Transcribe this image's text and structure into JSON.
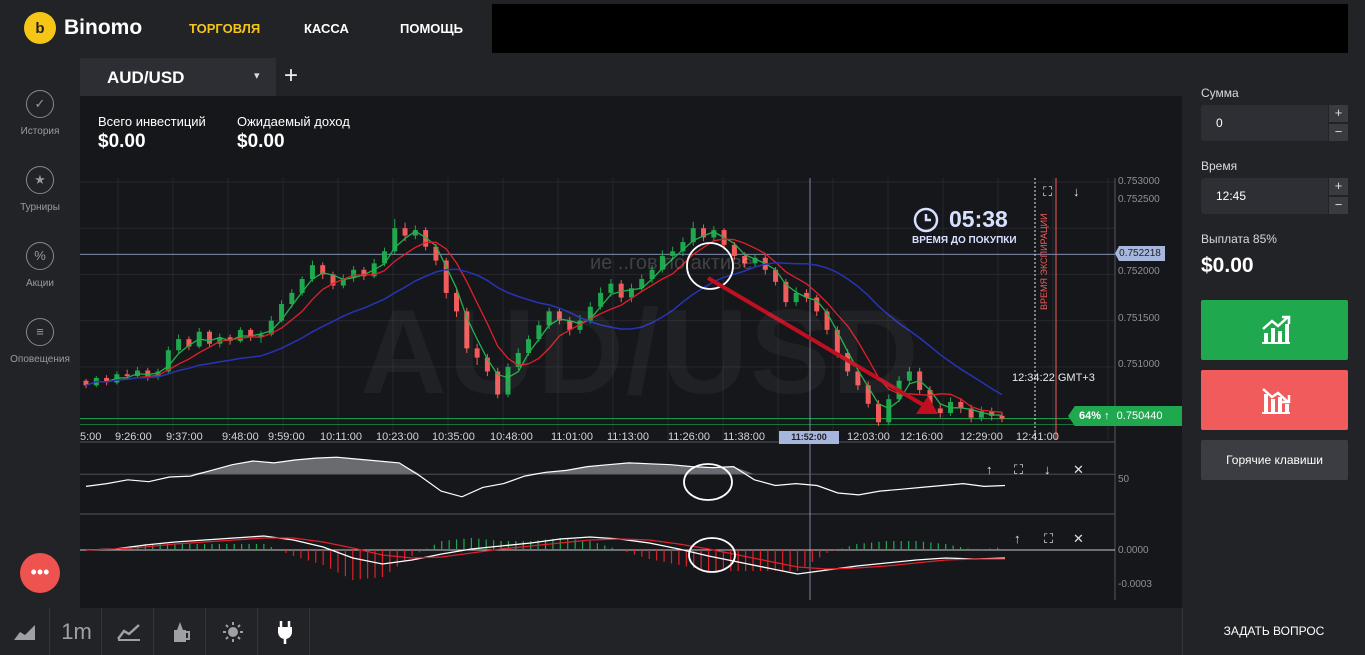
{
  "brand": {
    "name": "Binomo",
    "mark": "b"
  },
  "nav": {
    "trading": "ТОРГОВЛЯ",
    "cashier": "КАССА",
    "help": "ПОМОЩЬ"
  },
  "sidebar": {
    "items": [
      {
        "label": "История",
        "icon": "✓"
      },
      {
        "label": "Турниры",
        "icon": "★"
      },
      {
        "label": "Акции",
        "icon": "%"
      },
      {
        "label": "Оповещения",
        "icon": "≡"
      }
    ]
  },
  "asset_tab": {
    "label": "AUD/USD",
    "caret": "▾",
    "add": "+"
  },
  "stats": {
    "total_label": "Всего инвестиций",
    "total_value": "$0.00",
    "expected_label": "Ожидаемый доход",
    "expected_value": "$0.00"
  },
  "chart": {
    "watermark": "AUD/USD",
    "ghost_text": "ие ..гов по активе",
    "timer_value": "05:38",
    "timer_label": "ВРЕМЯ ДО ПОКУПКИ",
    "expiry_label": "ВРЕМЯ ЭКСПИРАЦИИ",
    "current_time": "12:34:22 GMT+3",
    "price_marker": "0.752218",
    "current_price": "0.750440",
    "payout_badge": "64%",
    "payout_arrow": "↑",
    "time_highlight": "11:52:00",
    "y_ticks": [
      "0.753000",
      "0.752500",
      "0.752000",
      "0.751500",
      "0.751000"
    ],
    "x_ticks": [
      "5:00",
      "9:26:00",
      "9:37:00",
      "9:48:00",
      "9:59:00",
      "10:11:00",
      "10:23:00",
      "10:35:00",
      "10:48:00",
      "11:01:00",
      "11:13:00",
      "11:26:00",
      "11:38:00",
      "12:03:00",
      "12:16:00",
      "12:29:00",
      "12:41:00"
    ],
    "osc1_tick": "50",
    "osc2_ticks": [
      "0.0000",
      "-0.0003"
    ],
    "candles": [
      [
        0.75085,
        0.7508,
        0.75087,
        0.75077
      ],
      [
        0.7508,
        0.75088,
        0.7509,
        0.75078
      ],
      [
        0.75088,
        0.75083,
        0.75091,
        0.7508
      ],
      [
        0.75083,
        0.75092,
        0.75095,
        0.75081
      ],
      [
        0.75092,
        0.7509,
        0.75097,
        0.75086
      ],
      [
        0.7509,
        0.75096,
        0.751,
        0.75088
      ],
      [
        0.75096,
        0.75089,
        0.75099,
        0.75085
      ],
      [
        0.75089,
        0.75095,
        0.75098,
        0.75086
      ],
      [
        0.75095,
        0.75118,
        0.75122,
        0.75093
      ],
      [
        0.75118,
        0.7513,
        0.75135,
        0.75114
      ],
      [
        0.7513,
        0.75122,
        0.75133,
        0.75118
      ],
      [
        0.75122,
        0.75138,
        0.75142,
        0.7512
      ],
      [
        0.75138,
        0.75125,
        0.7514,
        0.75121
      ],
      [
        0.75125,
        0.75132,
        0.75136,
        0.75121
      ],
      [
        0.75132,
        0.75128,
        0.75135,
        0.75124
      ],
      [
        0.75128,
        0.7514,
        0.75143,
        0.75126
      ],
      [
        0.7514,
        0.75132,
        0.75142,
        0.75128
      ],
      [
        0.75132,
        0.75135,
        0.75139,
        0.75126
      ],
      [
        0.75135,
        0.7515,
        0.75155,
        0.75133
      ],
      [
        0.7515,
        0.75168,
        0.75172,
        0.75148
      ],
      [
        0.75168,
        0.7518,
        0.75184,
        0.75164
      ],
      [
        0.7518,
        0.75195,
        0.75198,
        0.75177
      ],
      [
        0.75195,
        0.7521,
        0.75215,
        0.75192
      ],
      [
        0.7521,
        0.752,
        0.75213,
        0.75195
      ],
      [
        0.752,
        0.75188,
        0.75203,
        0.75184
      ],
      [
        0.75188,
        0.75196,
        0.752,
        0.75185
      ],
      [
        0.75196,
        0.75205,
        0.75209,
        0.75192
      ],
      [
        0.75205,
        0.75198,
        0.75208,
        0.75194
      ],
      [
        0.75198,
        0.75212,
        0.75217,
        0.75196
      ],
      [
        0.75212,
        0.75225,
        0.75229,
        0.75209
      ],
      [
        0.75225,
        0.7525,
        0.7526,
        0.75222
      ],
      [
        0.7525,
        0.75242,
        0.75256,
        0.75236
      ],
      [
        0.75242,
        0.75248,
        0.75253,
        0.75238
      ],
      [
        0.75248,
        0.7523,
        0.75251,
        0.75226
      ],
      [
        0.7523,
        0.75215,
        0.75233,
        0.7521
      ],
      [
        0.75215,
        0.7518,
        0.75218,
        0.75174
      ],
      [
        0.7518,
        0.7516,
        0.75184,
        0.75154
      ],
      [
        0.7516,
        0.7512,
        0.75164,
        0.75115
      ],
      [
        0.7512,
        0.7511,
        0.75125,
        0.75102
      ],
      [
        0.7511,
        0.75095,
        0.75114,
        0.7509
      ],
      [
        0.75095,
        0.7507,
        0.75099,
        0.75066
      ],
      [
        0.7507,
        0.751,
        0.75104,
        0.75067
      ],
      [
        0.751,
        0.75115,
        0.7512,
        0.75097
      ],
      [
        0.75115,
        0.7513,
        0.75134,
        0.75112
      ],
      [
        0.7513,
        0.75145,
        0.7515,
        0.75127
      ],
      [
        0.75145,
        0.7516,
        0.75164,
        0.75141
      ],
      [
        0.7516,
        0.7515,
        0.75163,
        0.75146
      ],
      [
        0.7515,
        0.7514,
        0.75154,
        0.75134
      ],
      [
        0.7514,
        0.7515,
        0.75156,
        0.75136
      ],
      [
        0.7515,
        0.75165,
        0.7517,
        0.75147
      ],
      [
        0.75165,
        0.7518,
        0.75186,
        0.75162
      ],
      [
        0.7518,
        0.7519,
        0.75195,
        0.75176
      ],
      [
        0.7519,
        0.75175,
        0.75194,
        0.7517
      ],
      [
        0.75175,
        0.75185,
        0.7519,
        0.7517
      ],
      [
        0.75185,
        0.75195,
        0.752,
        0.75182
      ],
      [
        0.75195,
        0.75205,
        0.7521,
        0.75191
      ],
      [
        0.75205,
        0.7522,
        0.75226,
        0.75202
      ],
      [
        0.7522,
        0.75225,
        0.7523,
        0.75216
      ],
      [
        0.75225,
        0.75235,
        0.7524,
        0.7522
      ],
      [
        0.75235,
        0.7525,
        0.75257,
        0.75231
      ],
      [
        0.7525,
        0.7524,
        0.75254,
        0.75236
      ],
      [
        0.7524,
        0.75248,
        0.75252,
        0.75236
      ],
      [
        0.75248,
        0.75232,
        0.7525,
        0.75228
      ],
      [
        0.75232,
        0.7522,
        0.75235,
        0.75216
      ],
      [
        0.7522,
        0.75212,
        0.75224,
        0.75208
      ],
      [
        0.75212,
        0.75218,
        0.75222,
        0.75208
      ],
      [
        0.75218,
        0.75205,
        0.75221,
        0.752
      ],
      [
        0.75205,
        0.75192,
        0.75208,
        0.75188
      ],
      [
        0.75192,
        0.7517,
        0.75195,
        0.75165
      ],
      [
        0.7517,
        0.7518,
        0.75186,
        0.75166
      ],
      [
        0.7518,
        0.75175,
        0.75184,
        0.7517
      ],
      [
        0.75175,
        0.7516,
        0.75178,
        0.75155
      ],
      [
        0.7516,
        0.7514,
        0.75163,
        0.75135
      ],
      [
        0.7514,
        0.75115,
        0.75144,
        0.7511
      ],
      [
        0.75115,
        0.75095,
        0.75119,
        0.7509
      ],
      [
        0.75095,
        0.7508,
        0.75099,
        0.75075
      ],
      [
        0.7508,
        0.7506,
        0.75084,
        0.75056
      ],
      [
        0.7506,
        0.7504,
        0.75064,
        0.75036
      ],
      [
        0.7504,
        0.75065,
        0.7507,
        0.75037
      ],
      [
        0.75065,
        0.75085,
        0.7509,
        0.75062
      ],
      [
        0.75085,
        0.75095,
        0.751,
        0.7508
      ],
      [
        0.75095,
        0.75075,
        0.75099,
        0.7507
      ],
      [
        0.75075,
        0.75055,
        0.75079,
        0.7505
      ],
      [
        0.75055,
        0.7505,
        0.7506,
        0.75045
      ],
      [
        0.7505,
        0.75062,
        0.75067,
        0.75047
      ],
      [
        0.75062,
        0.75055,
        0.75066,
        0.7505
      ],
      [
        0.75055,
        0.75045,
        0.75059,
        0.7504
      ],
      [
        0.75045,
        0.75052,
        0.75057,
        0.75041
      ],
      [
        0.75052,
        0.75047,
        0.75056,
        0.75042
      ],
      [
        0.75047,
        0.75044,
        0.75051,
        0.7504
      ]
    ],
    "osc1": [
      45,
      48,
      52,
      50,
      55,
      56,
      62,
      68,
      72,
      70,
      73,
      75,
      76,
      74,
      72,
      70,
      56,
      40,
      34,
      44,
      48,
      56,
      60,
      62,
      66,
      68,
      70,
      69,
      68,
      66,
      65,
      66,
      52,
      46,
      48,
      46,
      38,
      36,
      40,
      42,
      44,
      46,
      48,
      45,
      46
    ],
    "osc2_line": [
      0.0,
      1e-05,
      5e-05,
      8e-05,
      0.0001,
      0.00012,
      0.00014,
      0.0001,
      3e-05,
      -8e-05,
      -0.00014,
      -0.0001,
      -4e-05,
      1e-05,
      4e-05,
      7e-05,
      0.00011,
      0.00013,
      0.00011,
      7e-05,
      1e-05,
      -6e-05,
      -0.00012,
      -0.00018,
      -0.00024,
      -0.0002,
      -0.00016,
      -0.00013,
      -0.0001,
      -8e-05,
      -9e-05,
      -8e-05
    ],
    "osc2_signal": [
      0.0,
      1e-05,
      3e-05,
      6e-05,
      8e-05,
      0.0001,
      0.00012,
      0.00012,
      8e-05,
      2e-05,
      -5e-05,
      -8e-05,
      -7e-05,
      -3e-05,
      1e-05,
      4e-05,
      7e-05,
      0.0001,
      0.00011,
      0.0001,
      6e-05,
      1e-05,
      -5e-05,
      -0.00011,
      -0.00017,
      -0.00019,
      -0.00018,
      -0.00016,
      -0.00013,
      -0.0001,
      -9e-05,
      -9e-05
    ]
  },
  "trade": {
    "amount_label": "Сумма",
    "amount_value": "0",
    "time_label": "Время",
    "time_value": "12:45",
    "payout_label": "Выплата 85%",
    "payout_value": "$0.00",
    "plus": "+",
    "minus": "−",
    "hotkeys_label": "Горячие клавиши"
  },
  "toolbar": {
    "timeframe": "1m"
  },
  "ask_button": "ЗАДАТЬ ВОПРОС",
  "colors": {
    "brand": "#f5c518",
    "up": "#20a84f",
    "down": "#f15b5b",
    "accent": "#a7b6dc"
  }
}
